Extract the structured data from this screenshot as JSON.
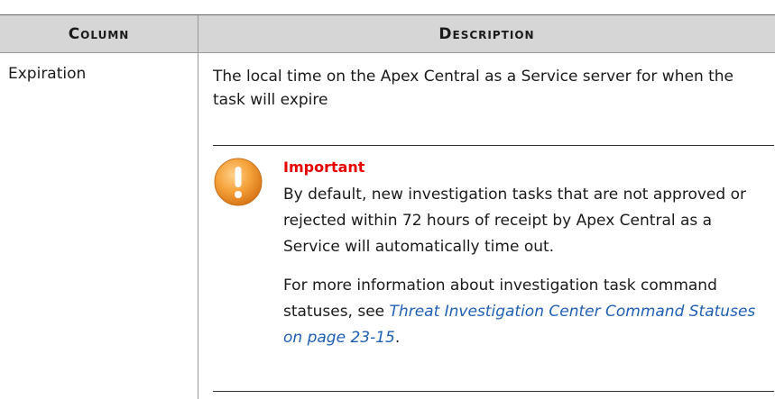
{
  "table": {
    "headers": [
      "Column",
      "Description"
    ],
    "rows": [
      {
        "name": "Expiration",
        "description": "The local time on the Apex Central as a Service server for when the task will expire"
      }
    ]
  },
  "note": {
    "icon": "warning-icon",
    "title": "Important",
    "paragraph1": "By default, new investigation tasks that are not approved or rejected within 72 hours of receipt by Apex Central as a Service will automatically time out.",
    "paragraph2_prefix": "For more information about investigation task command statuses, see ",
    "link_text": "Threat Investigation Center Command Statuses on page 23-15",
    "paragraph2_suffix": "."
  },
  "colors": {
    "header_bg": "#d6d6d6",
    "important_red": "#e60000",
    "link_blue": "#1f5fb4",
    "icon_orange": "#f39a2a"
  }
}
